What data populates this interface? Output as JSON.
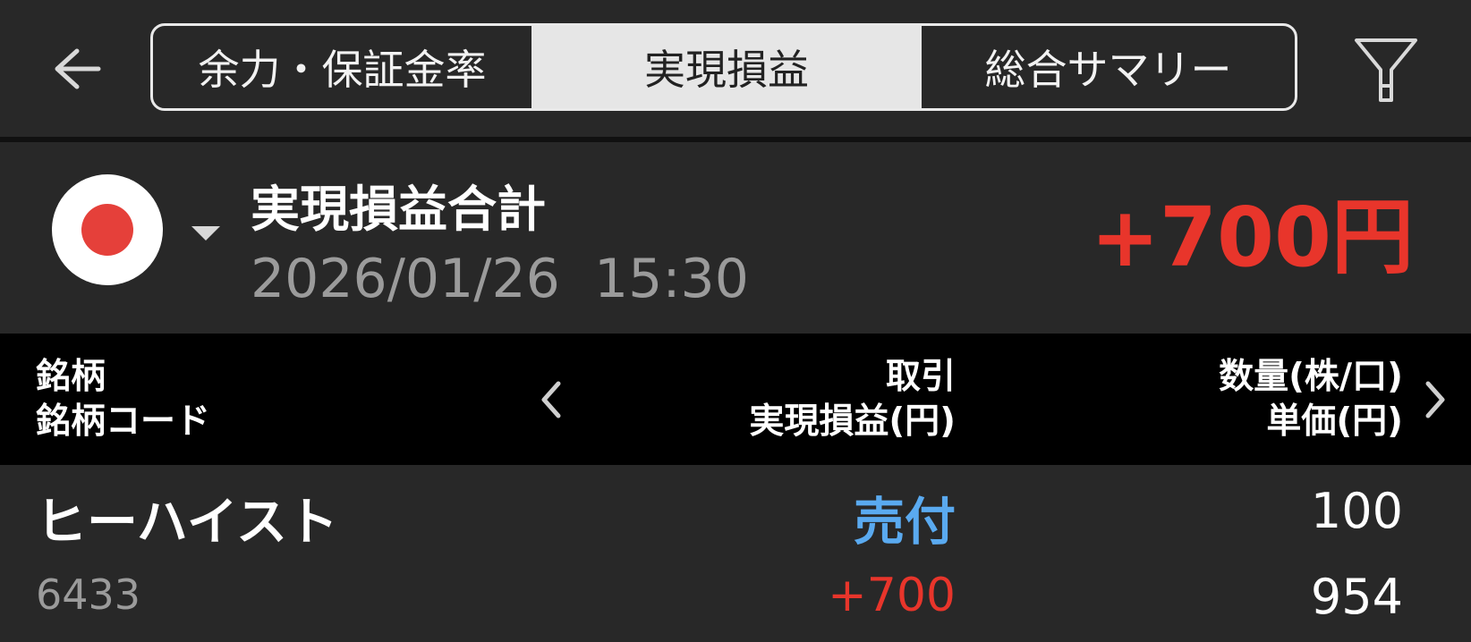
{
  "header": {
    "tabs": [
      {
        "label": "余力・保証金率",
        "selected": false
      },
      {
        "label": "実現損益",
        "selected": true
      },
      {
        "label": "総合サマリー",
        "selected": false
      }
    ],
    "back_icon": "arrow-left-icon",
    "filter_icon": "filter-icon"
  },
  "summary": {
    "market_icon": "japan-flag-icon",
    "title": "実現損益合計",
    "datetime": "2026/01/26  15:30",
    "total": "+700円"
  },
  "table": {
    "header": {
      "col1": [
        "銘柄",
        "銘柄コード"
      ],
      "col2": [
        "取引",
        "実現損益(円)"
      ],
      "col3": [
        "数量(株/口)",
        "単価(円)"
      ]
    },
    "rows": [
      {
        "name": "ヒーハイスト",
        "code": "6433",
        "trade": "売付",
        "pnl": "+700",
        "quantity": "100",
        "price": "954"
      }
    ]
  },
  "colors": {
    "background": "#282828",
    "table_header": "#000000",
    "profit": "#e8352b",
    "sell": "#5aaaf0",
    "muted": "#9b9b9b"
  }
}
